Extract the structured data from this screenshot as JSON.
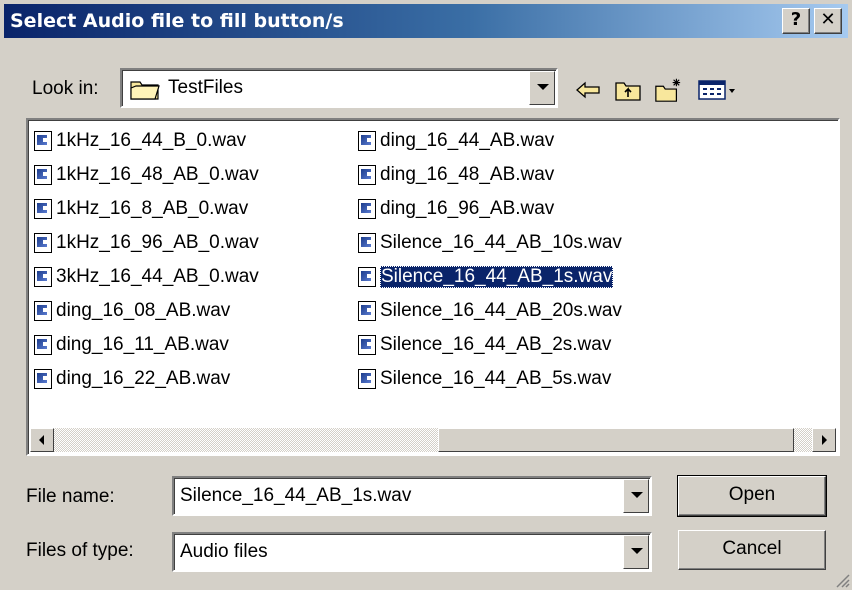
{
  "window": {
    "title": "Select Audio file to fill button/s",
    "help_label": "?",
    "close_label": "✕"
  },
  "lookin": {
    "label": "Look in:",
    "value": "TestFiles"
  },
  "files": {
    "column1": [
      "1kHz_16_44_B_0.wav",
      "1kHz_16_48_AB_0.wav",
      "1kHz_16_8_AB_0.wav",
      "1kHz_16_96_AB_0.wav",
      "3kHz_16_44_AB_0.wav",
      "ding_16_08_AB.wav",
      "ding_16_11_AB.wav",
      "ding_16_22_AB.wav"
    ],
    "column2": [
      "ding_16_44_AB.wav",
      "ding_16_48_AB.wav",
      "ding_16_96_AB.wav",
      "Silence_16_44_AB_10s.wav",
      "Silence_16_44_AB_1s.wav",
      "Silence_16_44_AB_20s.wav",
      "Silence_16_44_AB_2s.wav",
      "Silence_16_44_AB_5s.wav"
    ],
    "selected": "Silence_16_44_AB_1s.wav"
  },
  "filename": {
    "label": "File name:",
    "value": "Silence_16_44_AB_1s.wav"
  },
  "filetype": {
    "label": "Files of type:",
    "value": "Audio files"
  },
  "buttons": {
    "open": "Open",
    "cancel": "Cancel"
  },
  "colors": {
    "selection": "#0a246a",
    "title_start": "#0a246a",
    "title_end": "#a6caf0",
    "face": "#d4d0c8"
  }
}
